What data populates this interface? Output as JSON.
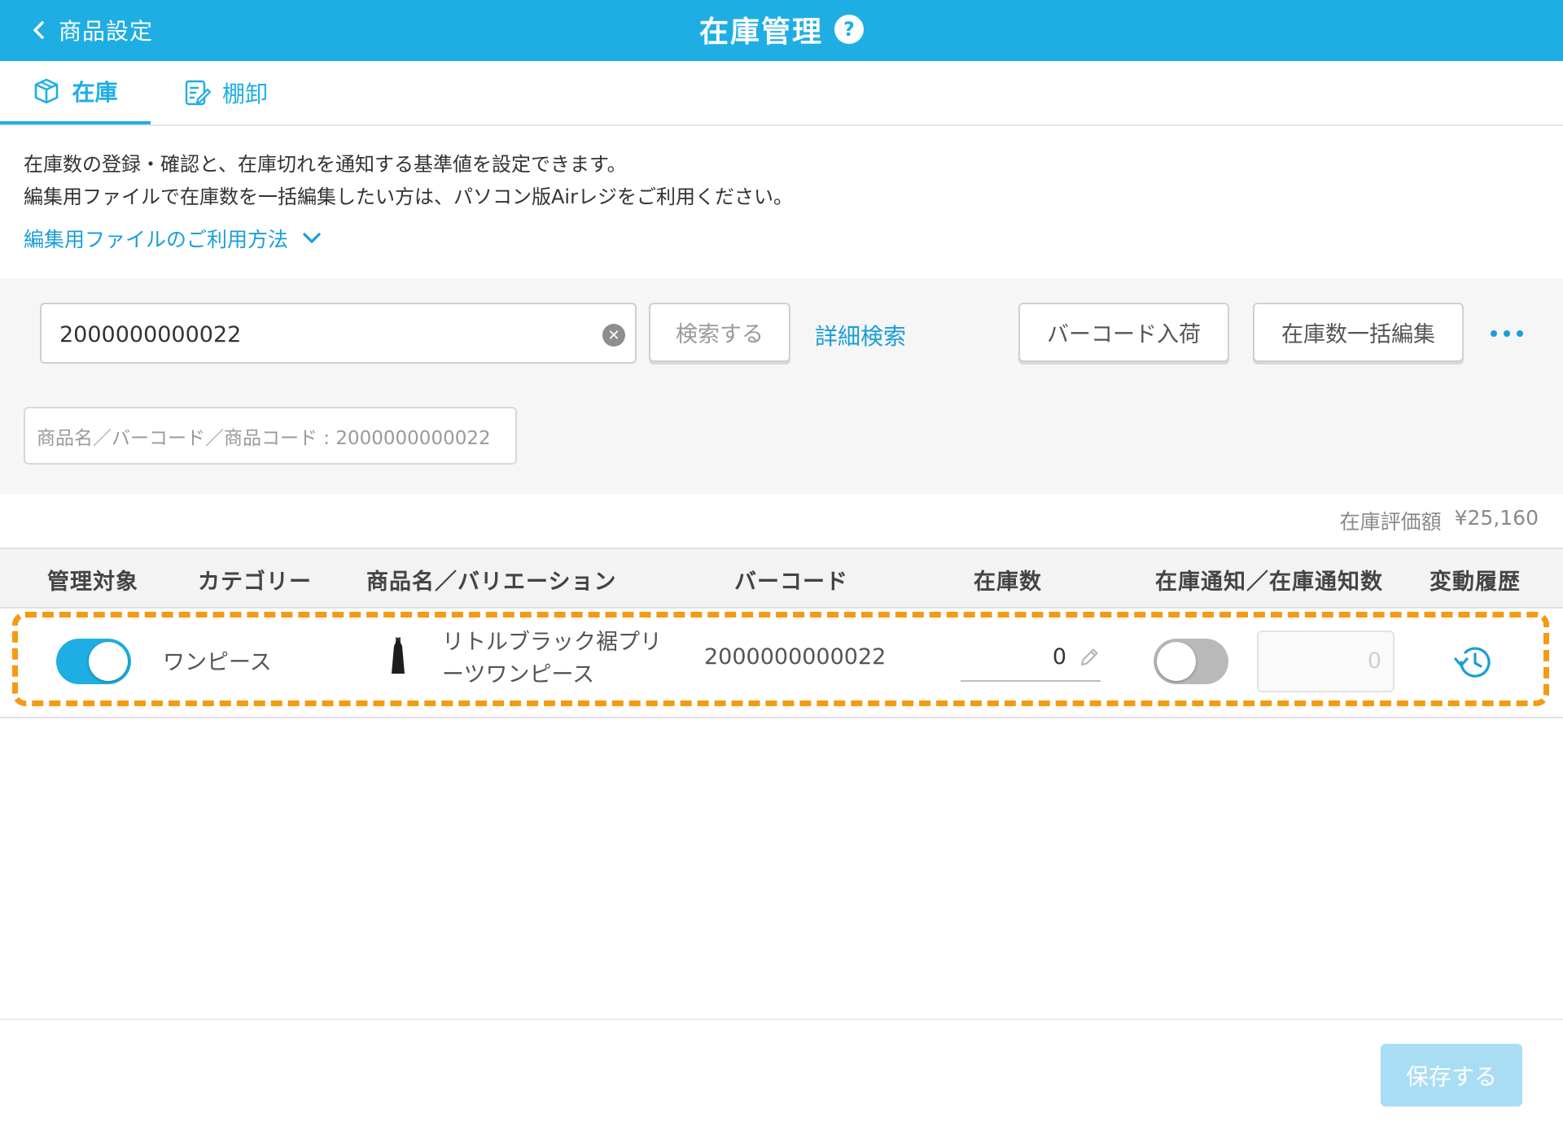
{
  "header": {
    "back_label": "商品設定",
    "title": "在庫管理",
    "help_symbol": "?"
  },
  "tabs": [
    {
      "label": "在庫",
      "icon": "box-icon",
      "active": true
    },
    {
      "label": "棚卸",
      "icon": "clipboard-edit-icon",
      "active": false
    }
  ],
  "description": {
    "line1": "在庫数の登録・確認と、在庫切れを通知する基準値を設定できます。",
    "line2": "編集用ファイルで在庫数を一括編集したい方は、パソコン版Airレジをご利用ください。",
    "help_link": "編集用ファイルのご利用方法"
  },
  "search": {
    "value": "2000000000022",
    "clear_symbol": "✕",
    "search_button": "検索する",
    "advanced_link": "詳細検索",
    "barcode_button": "バーコード入荷",
    "bulk_edit_button": "在庫数一括編集",
    "filter_chip": "商品名／バーコード／商品コード : 2000000000022"
  },
  "valuation": {
    "label": "在庫評価額",
    "amount": "¥25,160"
  },
  "table": {
    "headers": [
      "管理対象",
      "カテゴリー",
      "商品名／バリエーション",
      "バーコード",
      "在庫数",
      "在庫通知／在庫通知数",
      "変動履歴"
    ],
    "rows": [
      {
        "managed": true,
        "category": "ワンピース",
        "product_line1": "リトルブラック裾プリ",
        "product_line2": "ーツワンピース",
        "barcode": "2000000000022",
        "stock": "0",
        "notify": false,
        "notify_count": "0"
      }
    ]
  },
  "footer": {
    "save_button": "保存する"
  },
  "colors": {
    "brand": "#1eaee3",
    "link": "#1a9ed8",
    "highlight": "#f59a12",
    "save_disabled": "#a9ddf4"
  }
}
